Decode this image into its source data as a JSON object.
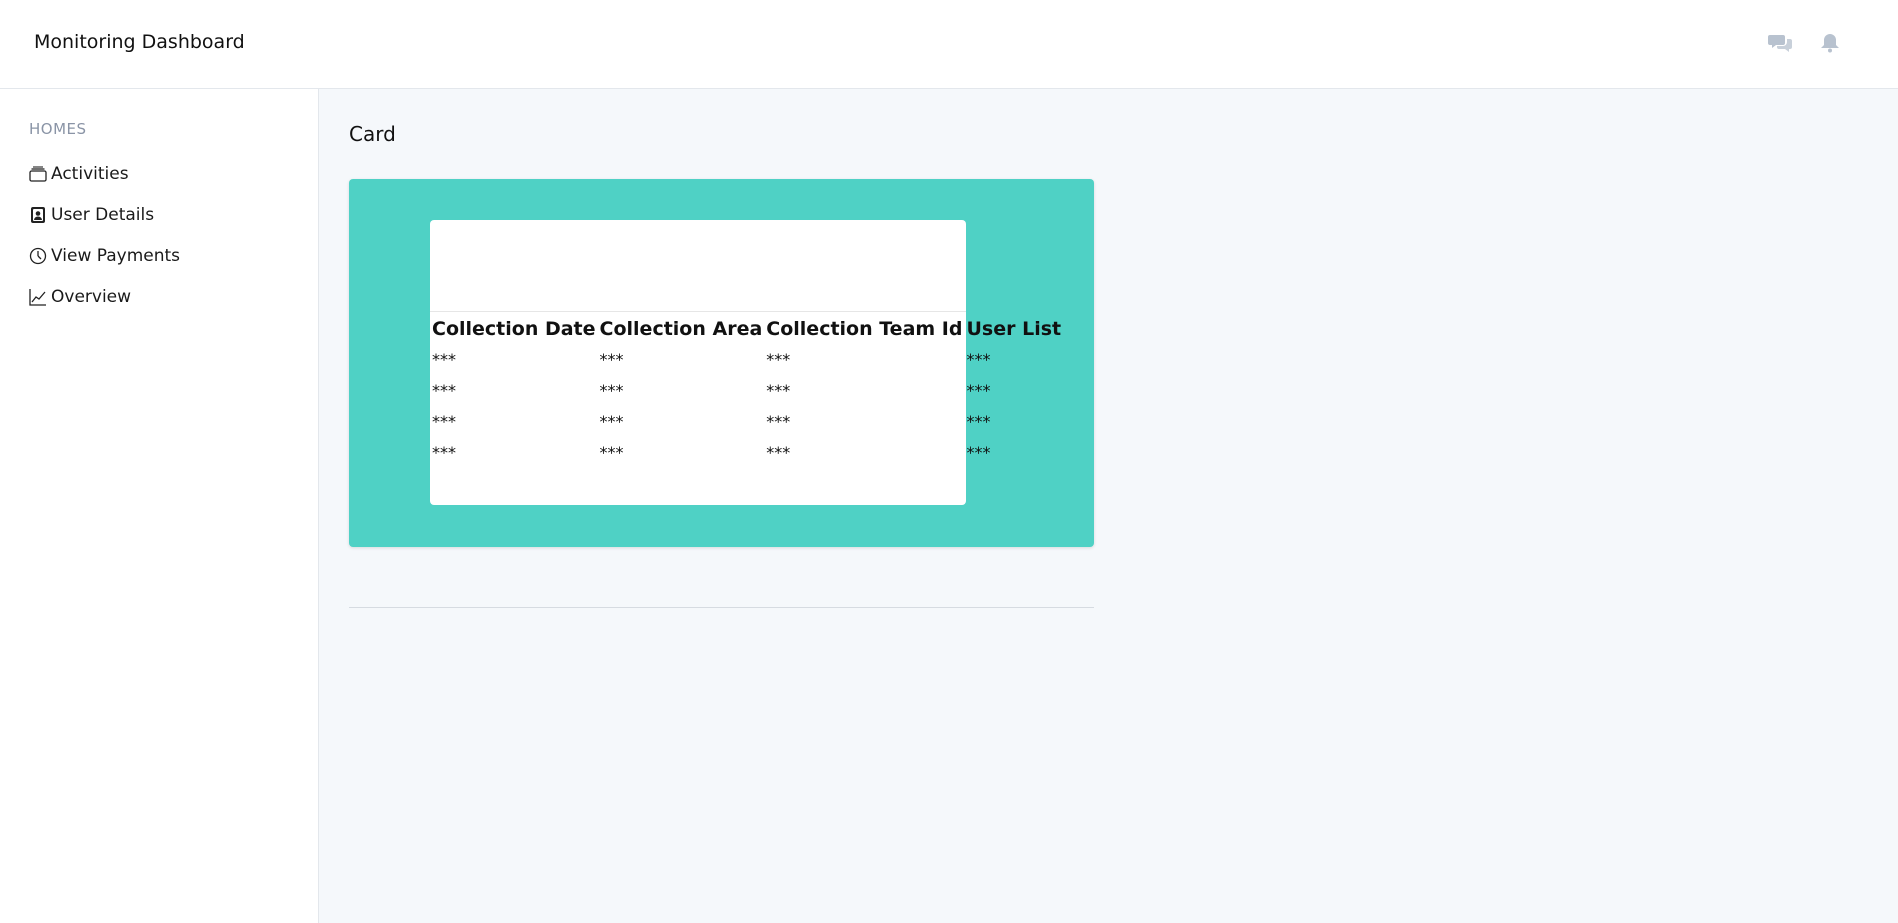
{
  "header": {
    "title": "Monitoring Dashboard",
    "icons": [
      "chat-icon",
      "bell-icon"
    ]
  },
  "sidebar": {
    "section": "HOMES",
    "items": [
      {
        "label": "Activities",
        "icon": "briefcase-icon"
      },
      {
        "label": "User Details",
        "icon": "contact-icon"
      },
      {
        "label": "View Payments",
        "icon": "clock-icon"
      },
      {
        "label": "Overview",
        "icon": "line-chart-icon"
      }
    ]
  },
  "main": {
    "title": "Card",
    "card": {
      "accent_color": "#4fd1c5",
      "table": {
        "columns": [
          "Collection Date",
          "Collection Area",
          "Collection Team Id",
          "User List"
        ],
        "rows": [
          [
            "***",
            "***",
            "***",
            "***"
          ],
          [
            "***",
            "***",
            "***",
            "***"
          ],
          [
            "***",
            "***",
            "***",
            "***"
          ],
          [
            "***",
            "***",
            "***",
            "***"
          ]
        ]
      }
    }
  }
}
